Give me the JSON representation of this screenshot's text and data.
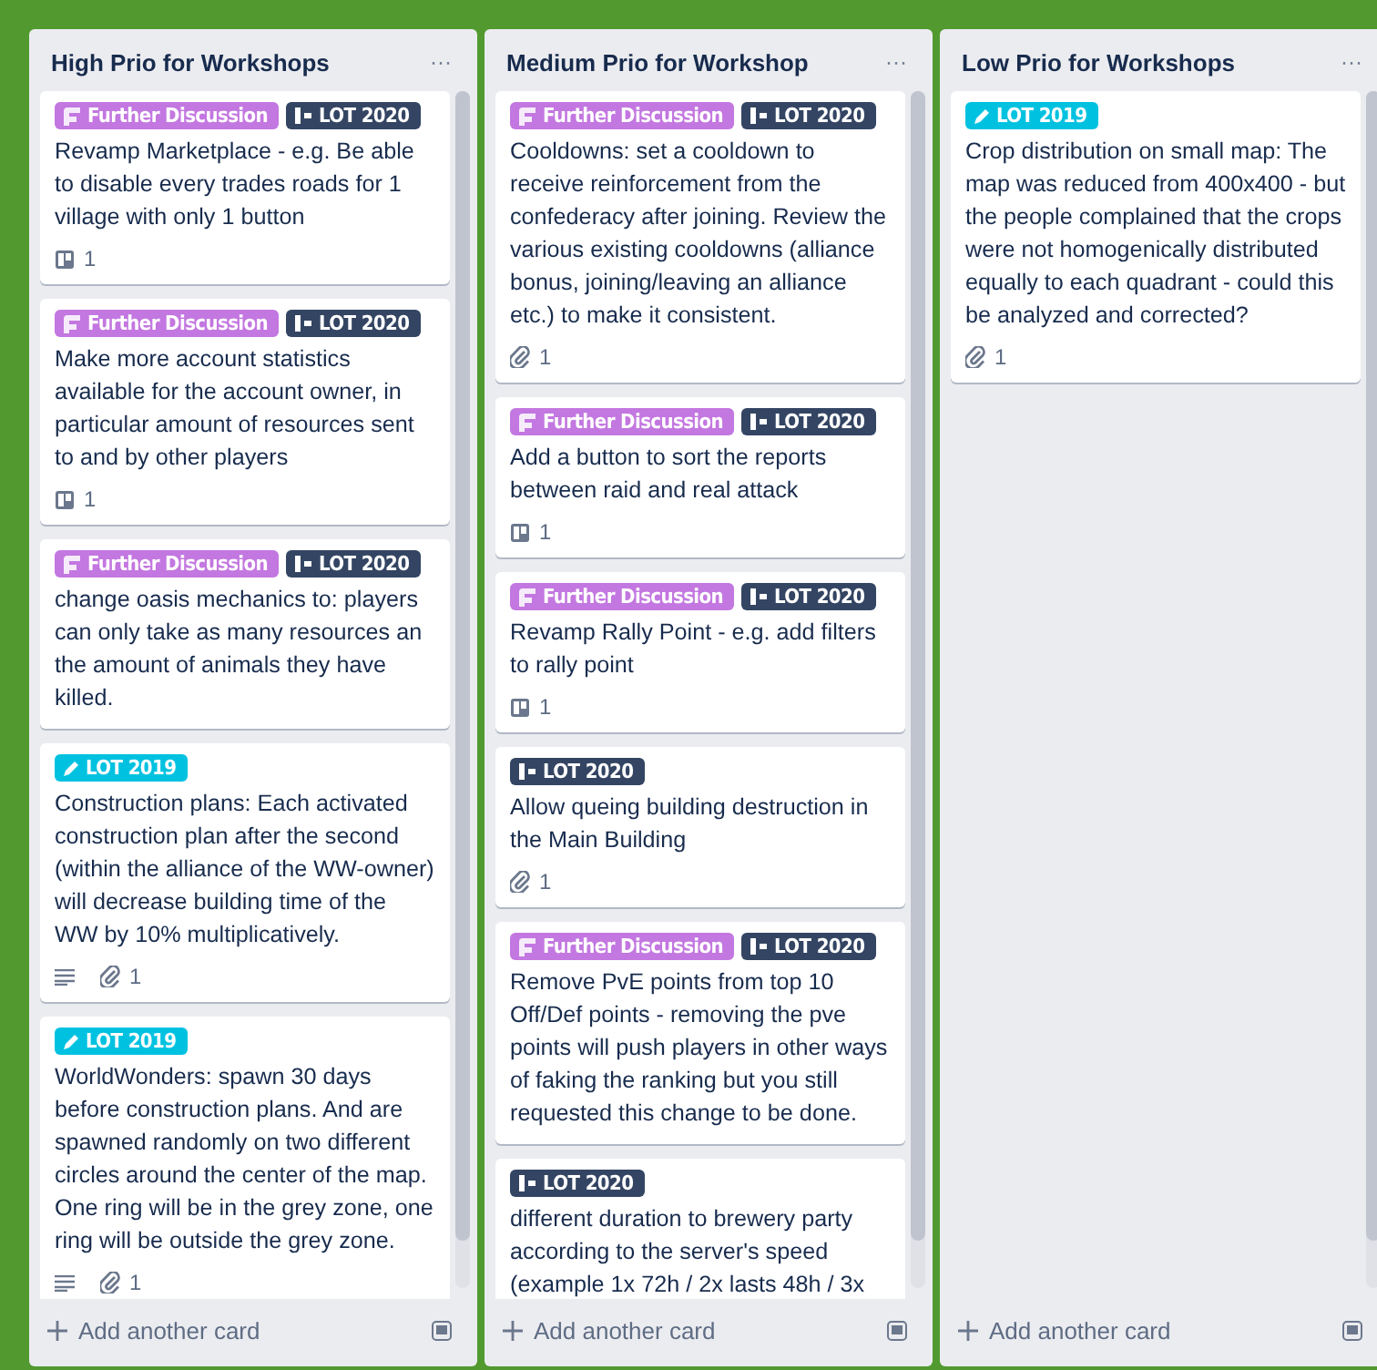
{
  "lists": [
    {
      "title": "High Prio for Workshops",
      "menu": "···",
      "add_card": "Add another card",
      "cards": [
        {
          "labels": [
            {
              "kind": "discussion",
              "text": "Further Discussion",
              "color": "#c377e0"
            },
            {
              "kind": "release",
              "text": "LOT 2020",
              "color": "#344563"
            }
          ],
          "text": "Revamp Marketplace - e.g. Be able to disable every trades roads for 1 village with only 1 button",
          "badges": [
            {
              "kind": "board",
              "count": "1"
            }
          ]
        },
        {
          "labels": [
            {
              "kind": "discussion",
              "text": "Further Discussion",
              "color": "#c377e0"
            },
            {
              "kind": "release",
              "text": "LOT 2020",
              "color": "#344563"
            }
          ],
          "text": "Make more account statistics available for the account owner, in particular amount of resources sent to and by other players",
          "badges": [
            {
              "kind": "board",
              "count": "1"
            }
          ]
        },
        {
          "labels": [
            {
              "kind": "discussion",
              "text": "Further Discussion",
              "color": "#c377e0"
            },
            {
              "kind": "release",
              "text": "LOT 2020",
              "color": "#344563"
            }
          ],
          "text": "change oasis mechanics to: players can only take as many resources an the amount of animals they have killed."
        },
        {
          "labels": [
            {
              "kind": "edit",
              "text": "LOT 2019",
              "color": "#00c2e0"
            }
          ],
          "text": "Construction plans: Each activated construction plan after the second (within the alliance of the WW-owner) will decrease building time of the WW by 10% multiplicatively.",
          "badges": [
            {
              "kind": "description"
            },
            {
              "kind": "attachment",
              "count": "1"
            }
          ]
        },
        {
          "labels": [
            {
              "kind": "edit",
              "text": "LOT 2019",
              "color": "#00c2e0"
            }
          ],
          "text": "WorldWonders: spawn 30 days before construction plans. And are spawned randomly on two different circles around the center of the map. One ring will be in the grey zone, one ring will be outside the grey zone.",
          "badges": [
            {
              "kind": "description"
            },
            {
              "kind": "attachment",
              "count": "1"
            }
          ]
        }
      ]
    },
    {
      "title": "Medium Prio for Workshop",
      "menu": "···",
      "add_card": "Add another card",
      "cards": [
        {
          "labels": [
            {
              "kind": "discussion",
              "text": "Further Discussion",
              "color": "#c377e0"
            },
            {
              "kind": "release",
              "text": "LOT 2020",
              "color": "#344563"
            }
          ],
          "text": "Cooldowns: set a cooldown to receive reinforcement from the confederacy after joining. Review the various existing cooldowns (alliance bonus, joining/leaving an alliance etc.) to make it consistent.",
          "badges": [
            {
              "kind": "attachment",
              "count": "1"
            }
          ]
        },
        {
          "labels": [
            {
              "kind": "discussion",
              "text": "Further Discussion",
              "color": "#c377e0"
            },
            {
              "kind": "release",
              "text": "LOT 2020",
              "color": "#344563"
            }
          ],
          "text": "Add a button to sort the reports between raid and real attack",
          "badges": [
            {
              "kind": "board",
              "count": "1"
            }
          ]
        },
        {
          "labels": [
            {
              "kind": "discussion",
              "text": "Further Discussion",
              "color": "#c377e0"
            },
            {
              "kind": "release",
              "text": "LOT 2020",
              "color": "#344563"
            }
          ],
          "text": "Revamp Rally Point - e.g. add filters to rally point",
          "badges": [
            {
              "kind": "board",
              "count": "1"
            }
          ]
        },
        {
          "labels": [
            {
              "kind": "release",
              "text": "LOT 2020",
              "color": "#344563"
            }
          ],
          "text": "Allow queing building destruction in the Main Building",
          "badges": [
            {
              "kind": "attachment",
              "count": "1"
            }
          ]
        },
        {
          "labels": [
            {
              "kind": "discussion",
              "text": "Further Discussion",
              "color": "#c377e0"
            },
            {
              "kind": "release",
              "text": "LOT 2020",
              "color": "#344563"
            }
          ],
          "text": "Remove PvE points from top 10 Off/Def points - removing the pve points will push players in other ways of faking the ranking but you still requested this change to be done."
        },
        {
          "labels": [
            {
              "kind": "release",
              "text": "LOT 2020",
              "color": "#344563"
            }
          ],
          "text": "different duration to brewery party according to the server's speed (example 1x 72h / 2x lasts 48h / 3x"
        }
      ]
    },
    {
      "title": "Low Prio for Workshops",
      "menu": "···",
      "add_card": "Add another card",
      "cards": [
        {
          "labels": [
            {
              "kind": "edit",
              "text": "LOT 2019",
              "color": "#00c2e0"
            }
          ],
          "text": "Crop distribution on small map: The map was reduced from 400x400 - but the people complained that the crops were not homogenically distributed equally to each quadrant - could this be analyzed and corrected?",
          "badges": [
            {
              "kind": "attachment",
              "count": "1"
            }
          ]
        }
      ]
    }
  ]
}
